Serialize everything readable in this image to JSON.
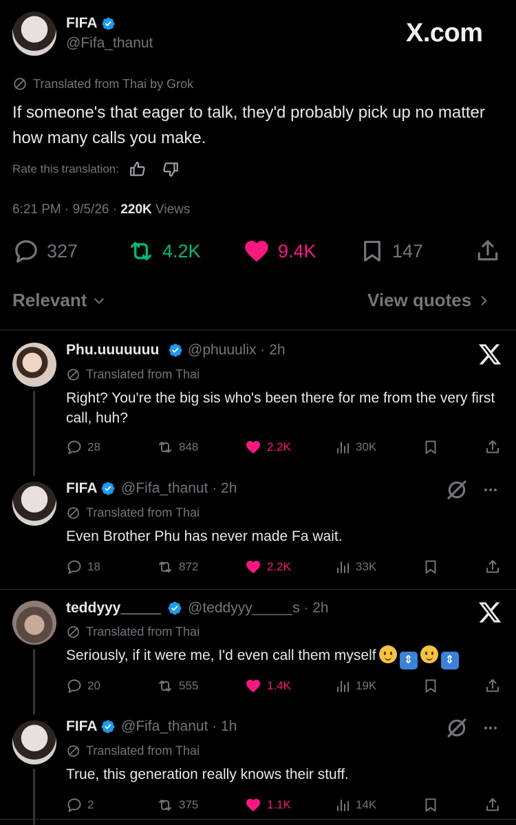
{
  "main_post": {
    "name": "FIFA",
    "handle": "@Fifa_thanut",
    "brand": "X.com",
    "translated": "Translated from Thai by Grok",
    "text": "If someone's that eager to talk, they'd probably pick up no matter how many calls you make.",
    "rate_label": "Rate this translation:",
    "time": "6:21 PM · 9/5/26 · ",
    "views_count": "220K",
    "views_label": " Views",
    "replies": "327",
    "reposts": "4.2K",
    "likes": "9.4K",
    "bookmarks": "147"
  },
  "filters": {
    "sort": "Relevant",
    "quotes": "View quotes"
  },
  "replies": [
    {
      "name": "Phu.uuuuuuu",
      "handle": "@phuuulix · 2h",
      "translated": "Translated from Thai",
      "text": "Right? You're the big sis who's been there for me from the very first call, huh?",
      "replies": "28",
      "reposts": "848",
      "likes": "2.2K",
      "views": "30K"
    },
    {
      "name": "FIFA",
      "handle": "@Fifa_thanut · 2h",
      "translated": "Translated from Thai",
      "text": "Even Brother Phu has never made Fa wait.",
      "replies": "18",
      "reposts": "872",
      "likes": "2.2K",
      "views": "33K"
    },
    {
      "name": "teddyyy_____",
      "handle": "@teddyyy_____s · 2h",
      "translated": "Translated from Thai",
      "text": "Seriously, if it were me, I'd even call them myself",
      "replies": "20",
      "reposts": "555",
      "likes": "1.4K",
      "views": "19K"
    },
    {
      "name": "FIFA",
      "handle": "@Fifa_thanut · 1h",
      "translated": "Translated from Thai",
      "text": "True, this generation really knows their stuff.",
      "replies": "2",
      "reposts": "375",
      "likes": "1.1K",
      "views": "14K"
    }
  ],
  "colors": {
    "accent_blue": "#1d9bf0",
    "like_pink": "#f91880",
    "repost_green": "#00ba7c",
    "muted": "#71767b"
  },
  "icons": [
    "verified-badge-icon",
    "translate-icon",
    "thumbs-up-icon",
    "thumbs-down-icon",
    "reply-icon",
    "repost-icon",
    "heart-icon",
    "bookmark-icon",
    "share-icon",
    "views-icon",
    "x-logo-icon",
    "grok-icon",
    "more-icon",
    "chevron-down-icon",
    "chevron-right-icon"
  ]
}
